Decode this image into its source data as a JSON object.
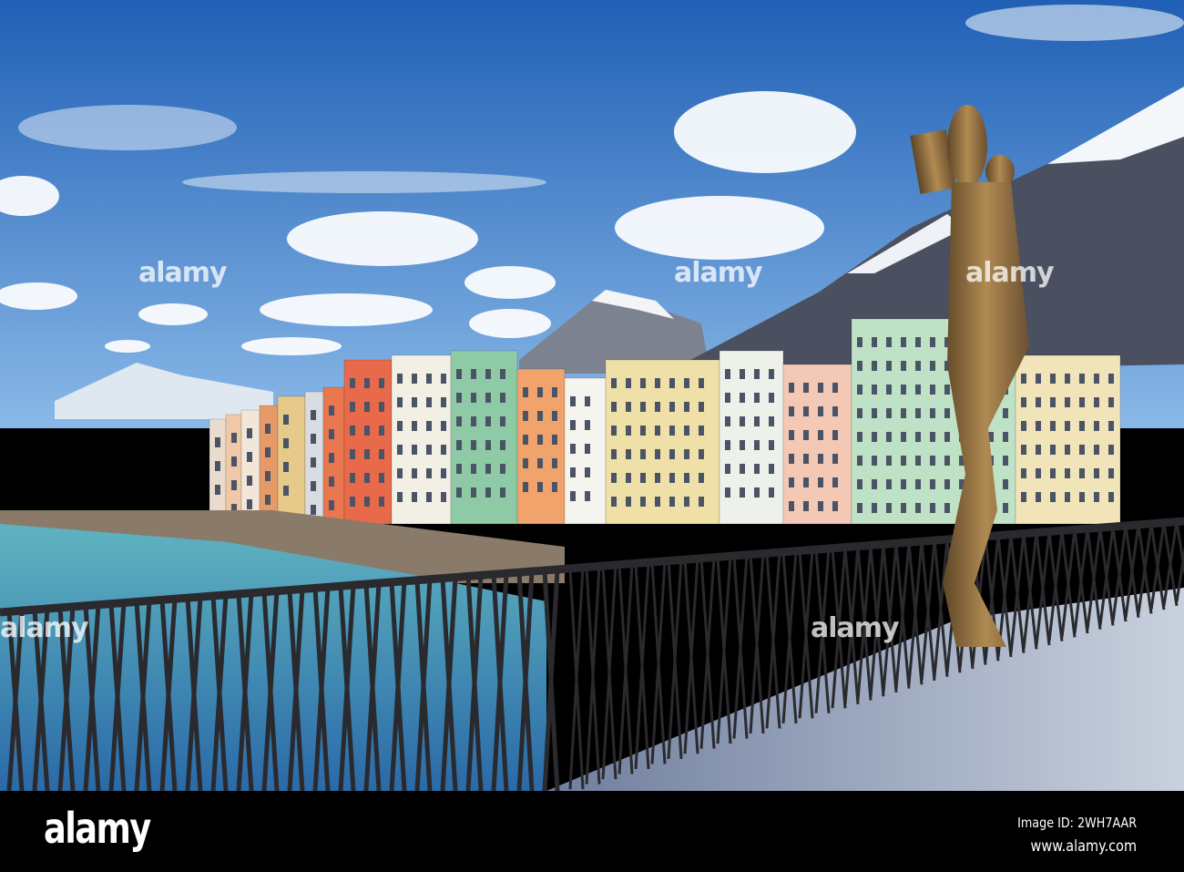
{
  "photo": {
    "subject": "Innsbruck riverside houses and bridge railing with bronze statue",
    "colors": {
      "sky_top": "#1f5fb5",
      "sky_bottom": "#7fb3e6",
      "river": "#4aa3b5",
      "railing": "#2a2a2e",
      "walkway": "#b9c3d6",
      "statue": "#8a6a3a"
    },
    "building_colors": [
      "#e9dccf",
      "#efc9a7",
      "#f1e6d8",
      "#e69a68",
      "#e7c98a",
      "#d9dde2",
      "#e9774f",
      "#e86a4a",
      "#f2efe4",
      "#8fcaa6",
      "#f0a36a",
      "#f6f4ef",
      "#efe0a8",
      "#eef0ea",
      "#f3c8b4",
      "#bfe2c6",
      "#f0e4b8"
    ]
  },
  "watermark": {
    "logo": "alamy",
    "image_id": "Image ID: 2WH7AAR",
    "url": "www.alamy.com"
  }
}
